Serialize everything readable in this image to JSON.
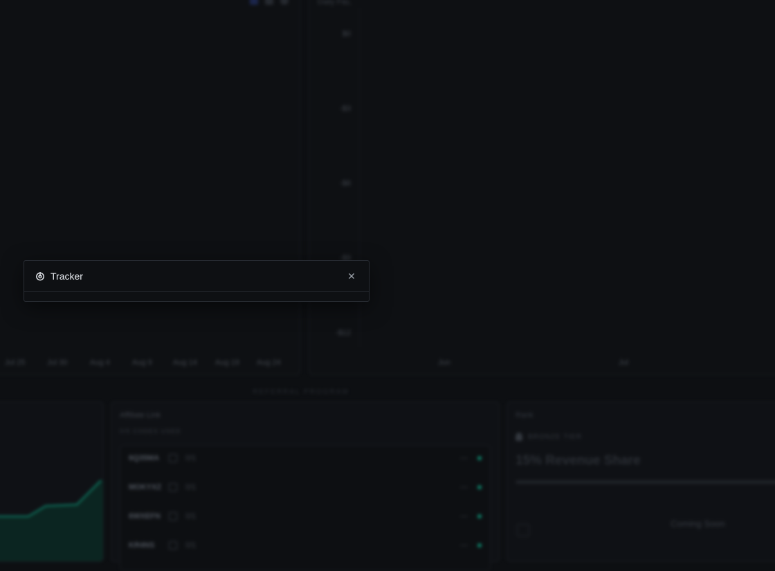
{
  "dialog": {
    "title": "Tracker",
    "icon": "tracker-icon",
    "close_icon": "close-icon"
  },
  "left_chart": {
    "x_ticks": [
      "Jul 25",
      "Jul 30",
      "Aug 4",
      "Aug 9",
      "Aug 14",
      "Aug 19",
      "Aug 24"
    ],
    "toolbar_icons": [
      "line-chart-icon",
      "bar-chart-icon",
      "pie-icon"
    ]
  },
  "right_chart": {
    "label": "Daily P&L",
    "y_ticks": [
      "$0",
      "-$3",
      "-$6",
      "-$9",
      "-$12"
    ],
    "x_ticks": [
      "Jun",
      "Jul"
    ]
  },
  "section_divider": "REFERRAL PROGRAM",
  "affiliate": {
    "title": "Affiliate Link",
    "codes_used": "0/5 CODES USED",
    "rows": [
      {
        "code": "6Q35MA",
        "uses": "0/1",
        "status": "---"
      },
      {
        "code": "MOKYXZ",
        "uses": "0/1",
        "status": "---"
      },
      {
        "code": "6WXEFN",
        "uses": "0/1",
        "status": "---"
      },
      {
        "code": "KR4NS",
        "uses": "0/1",
        "status": "---"
      }
    ]
  },
  "rank": {
    "title": "Rank",
    "tier": "BRONZE TIER",
    "share": "15% Revenue Share",
    "coming_soon": "Coming Soon"
  },
  "colors": {
    "accent": "#0e9a7c",
    "background": "#0d0f12"
  }
}
